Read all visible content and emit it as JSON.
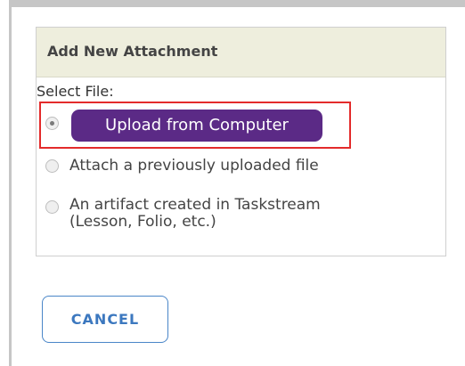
{
  "dialog": {
    "title": "Add New Attachment",
    "select_label": "Select File:",
    "options": [
      {
        "label": "Upload from Computer",
        "selected": true
      },
      {
        "label": "Attach a previously uploaded file",
        "selected": false
      },
      {
        "label_line1": "An artifact created in Taskstream",
        "label_line2": "(Lesson, Folio, etc.)",
        "selected": false
      }
    ],
    "cancel_label": "CANCEL"
  },
  "colors": {
    "header_bg": "#eeeedd",
    "upload_button": "#5b2a86",
    "highlight": "#e32b2b",
    "cancel_text": "#3c78bf"
  }
}
